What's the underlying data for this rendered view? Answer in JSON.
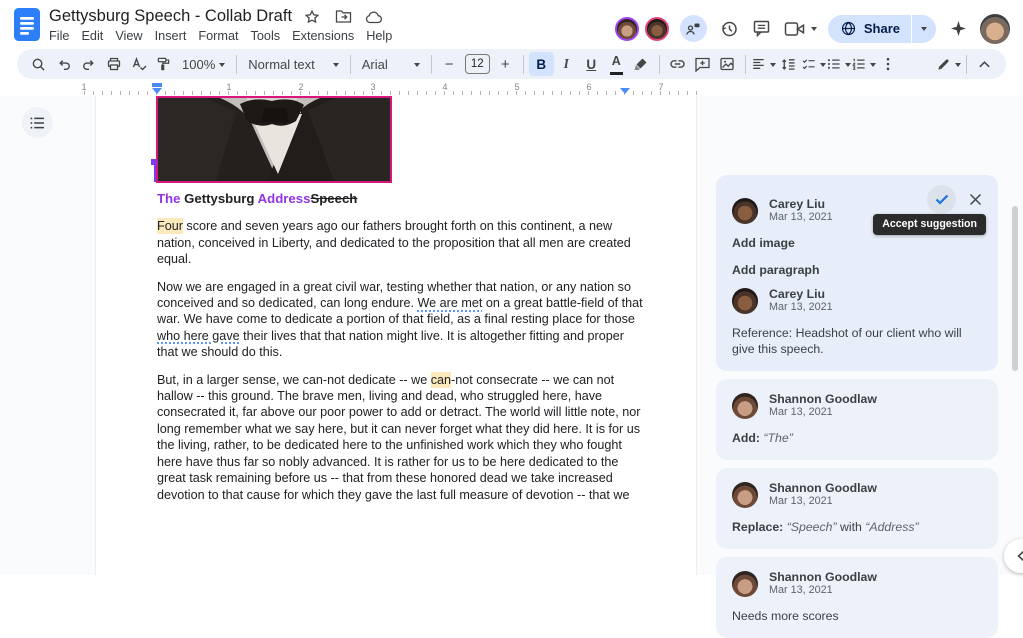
{
  "titlebar": {
    "title": "Gettysburg Speech - Collab Draft",
    "menus": [
      "File",
      "Edit",
      "View",
      "Insert",
      "Format",
      "Tools",
      "Extensions",
      "Help"
    ],
    "share_label": "Share"
  },
  "toolbar": {
    "zoom_value": "100%",
    "paragraph_style": "Normal text",
    "font_family": "Arial",
    "font_size": "12",
    "bold_label": "B",
    "italic_label": "I",
    "underline_label": "U",
    "text_color_label": "A"
  },
  "ruler": {
    "margin_number": "1",
    "numbers": [
      "1",
      "2",
      "3",
      "4",
      "5",
      "6",
      "7"
    ]
  },
  "document": {
    "heading": [
      {
        "t": "The",
        "s": "ins b"
      },
      {
        "t": " ",
        "s": "b"
      },
      {
        "t": "Gettysburg ",
        "s": "b"
      },
      {
        "t": "Address",
        "s": "ins b"
      },
      {
        "t": "Speech",
        "s": "del b"
      }
    ],
    "paragraphs": [
      {
        "lines": [
          [
            {
              "t": "Four",
              "s": "hl"
            },
            {
              "t": " score and seven years ago our fathers brought forth on this continent, a new"
            }
          ],
          [
            {
              "t": "nation, conceived in Liberty, and dedicated to the proposition that all men are created"
            }
          ],
          [
            {
              "t": "equal."
            }
          ]
        ]
      },
      {
        "lines": [
          [
            {
              "t": "Now we are engaged in a great civil war, testing whether that nation, or any nation so"
            }
          ],
          [
            {
              "t": "conceived and so dedicated, can long endure. "
            },
            {
              "t": "We are met",
              "s": "g"
            },
            {
              "t": " on a great battle-field of that"
            }
          ],
          [
            {
              "t": "war. We have come to dedicate a portion of that field, as a final resting place for those"
            }
          ],
          [
            {
              "t": "who here gave",
              "s": "g"
            },
            {
              "t": " their lives that that nation might live. It is altogether fitting and proper"
            }
          ],
          [
            {
              "t": "that we should do this."
            }
          ]
        ]
      },
      {
        "lines": [
          [
            {
              "t": "But, in a larger sense, we can-not dedicate -- we "
            },
            {
              "t": "can",
              "s": "hl"
            },
            {
              "t": "-not consecrate -- we can not"
            }
          ],
          [
            {
              "t": "hallow -- this ground. The brave men, living and dead, who struggled here, have"
            }
          ],
          [
            {
              "t": "consecrated it, far above our poor power to add or detract. The world will little note, nor"
            }
          ],
          [
            {
              "t": "long remember what we say here, but it can never forget what they did here. It is for us"
            }
          ],
          [
            {
              "t": "the living, rather, to be dedicated here to the unfinished work which they who fought"
            }
          ],
          [
            {
              "t": "here have thus far so nobly advanced. It is rather for us to be here dedicated to the"
            }
          ],
          [
            {
              "t": "great task remaining before us -- that from these honored dead we take increased"
            }
          ],
          [
            {
              "t": "devotion to that cause for which they gave the last full measure of devotion -- that we"
            }
          ]
        ]
      }
    ]
  },
  "comments": {
    "tooltip": "Accept suggestion",
    "cards": [
      {
        "selected": true,
        "actions": true,
        "items": [
          {
            "type": "header",
            "author": "Carey Liu",
            "date": "Mar 13, 2021",
            "avatar": "a1"
          },
          {
            "type": "line",
            "segs": [
              {
                "t": "Add image",
                "b": true
              }
            ]
          },
          {
            "type": "line",
            "segs": [
              {
                "t": "Add paragraph",
                "b": true
              }
            ]
          },
          {
            "type": "header",
            "author": "Carey Liu",
            "date": "Mar 13, 2021",
            "avatar": "a1"
          },
          {
            "type": "line",
            "segs": [
              {
                "t": "Reference: Headshot of our client who will give this speech."
              }
            ]
          }
        ]
      },
      {
        "selected": false,
        "actions": false,
        "items": [
          {
            "type": "header",
            "author": "Shannon Goodlaw",
            "date": "Mar 13, 2021",
            "avatar": "a2"
          },
          {
            "type": "line",
            "segs": [
              {
                "t": "Add: ",
                "b": true
              },
              {
                "t": "“The”",
                "i": true
              }
            ]
          }
        ]
      },
      {
        "selected": false,
        "actions": false,
        "items": [
          {
            "type": "header",
            "author": "Shannon Goodlaw",
            "date": "Mar 13, 2021",
            "avatar": "a2"
          },
          {
            "type": "line",
            "segs": [
              {
                "t": "Replace: ",
                "b": true
              },
              {
                "t": "“Speech”",
                "i": true
              },
              {
                "t": " with "
              },
              {
                "t": "“Address”",
                "i": true
              }
            ]
          }
        ]
      },
      {
        "selected": false,
        "actions": false,
        "items": [
          {
            "type": "header",
            "author": "Shannon Goodlaw",
            "date": "Mar 13, 2021",
            "avatar": "a2"
          },
          {
            "type": "line",
            "segs": [
              {
                "t": "Needs more scores"
              }
            ]
          }
        ]
      }
    ]
  }
}
